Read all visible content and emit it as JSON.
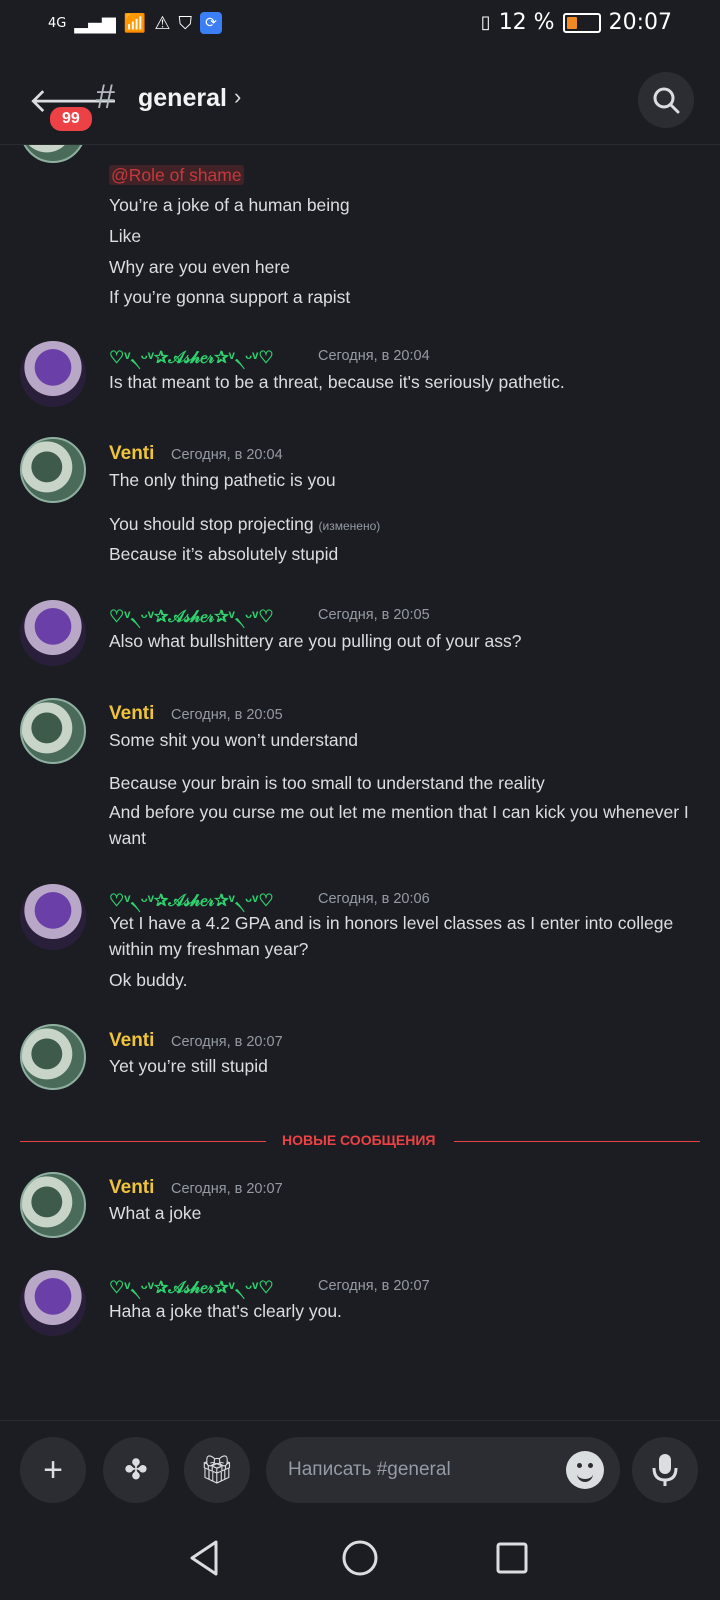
{
  "status_bar": {
    "network": "4G",
    "battery_text": "12 %",
    "battery_level": 0.12,
    "time": "20:07"
  },
  "header": {
    "unread_badge": "99",
    "channel_name": "general"
  },
  "messages": [
    {
      "lines": [
        "@Role of shame",
        "You’re a joke of a human being",
        "Like",
        "Why are you even here",
        "If you’re gonna support a rapist"
      ]
    },
    {
      "author": "♡ᵛ৲ᵕᵛ✰𝒜𝓈𝒽𝑒𝓇✰ᵛ৲ᵕᵛ♡",
      "time": "Сегодня, в 20:04",
      "lines": [
        "Is that meant to be a threat, because it's seriously pathetic."
      ]
    },
    {
      "author": "Venti",
      "time": "Сегодня, в 20:04",
      "lines": [
        "The only thing pathetic is you",
        "You should stop projecting",
        "Because it’s absolutely stupid"
      ],
      "edited": "(изменено)"
    },
    {
      "author": "♡ᵛ৲ᵕᵛ✰𝒜𝓈𝒽𝑒𝓇✰ᵛ৲ᵕᵛ♡",
      "time": "Сегодня, в 20:05",
      "lines": [
        "Also what bullshittery are you pulling out of your ass?"
      ]
    },
    {
      "author": "Venti",
      "time": "Сегодня, в 20:05",
      "lines": [
        "Some shit you won’t understand",
        "Because your brain is too small to understand the reality",
        "And before you curse me out let me mention that I can kick you whenever I want"
      ]
    },
    {
      "author": "♡ᵛ৲ᵕᵛ✰𝒜𝓈𝒽𝑒𝓇✰ᵛ৲ᵕᵛ♡",
      "time": "Сегодня, в 20:06",
      "lines": [
        "Yet I have a 4.2 GPA and is in honors level classes as I enter into college within my freshman year?",
        "Ok buddy."
      ]
    },
    {
      "author": "Venti",
      "time": "Сегодня, в 20:07",
      "lines": [
        "Yet you’re still stupid"
      ]
    },
    {
      "author": "Venti",
      "time": "Сегодня, в 20:07",
      "lines": [
        "What a joke"
      ]
    },
    {
      "author": "♡ᵛ৲ᵕᵛ✰𝒜𝓈𝒽𝑒𝓇✰ᵛ৲ᵕᵛ♡",
      "time": "Сегодня, в 20:07",
      "lines": [
        "Haha a joke that's clearly you."
      ]
    }
  ],
  "divider_label": "НОВЫЕ СООБЩЕНИЯ",
  "composer": {
    "placeholder": "Написать #general"
  },
  "colors": {
    "background": "#1c1d22",
    "venti_name": "#f0c43a",
    "asher_name": "#2fd06e",
    "accent_red": "#ed4245"
  }
}
